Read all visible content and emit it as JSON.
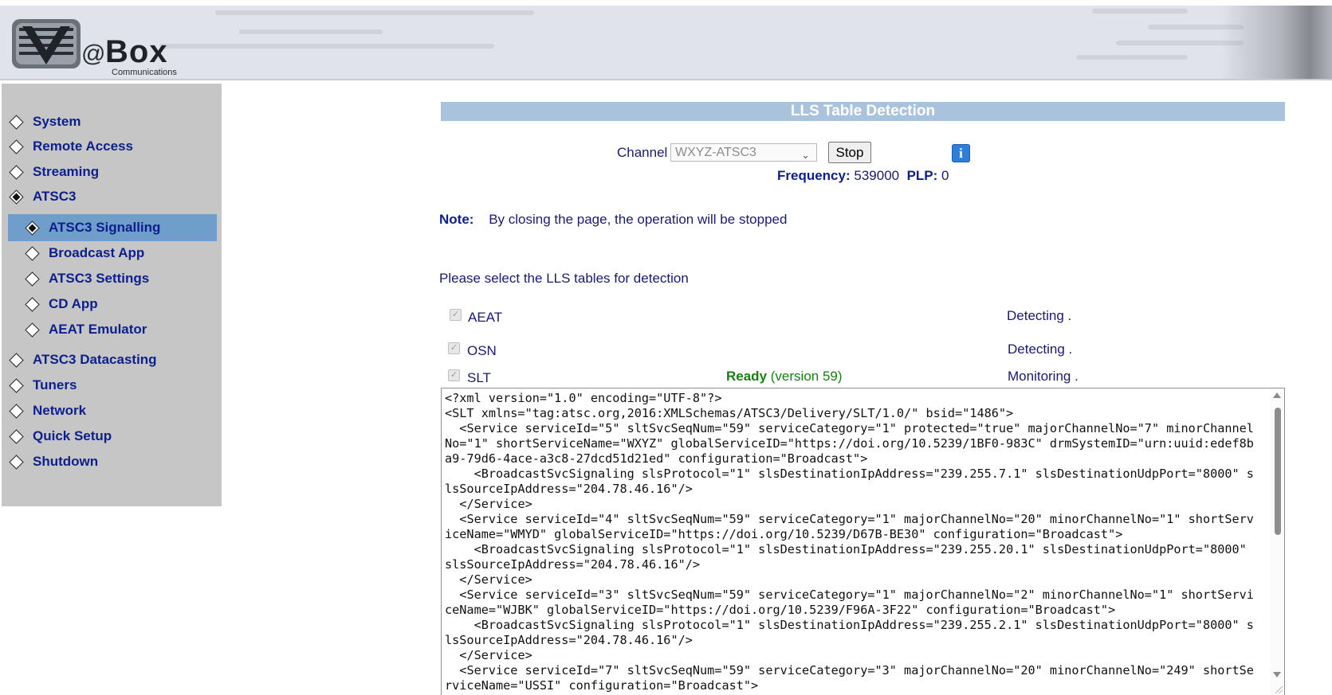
{
  "header": {
    "brand_icon": "vabox-logo",
    "brand_at": "@",
    "brand_box": "Box",
    "brand_sub": "Communications"
  },
  "sidebar": {
    "items": [
      {
        "label": "System",
        "icon": "diamond-icon"
      },
      {
        "label": "Remote Access",
        "icon": "diamond-icon"
      },
      {
        "label": "Streaming",
        "icon": "diamond-icon"
      },
      {
        "label": "ATSC3",
        "icon": "diamond-filled-icon"
      },
      {
        "label": "ATSC3 Signalling",
        "icon": "diamond-filled-icon",
        "active": true
      },
      {
        "label": "Broadcast App",
        "icon": "diamond-icon"
      },
      {
        "label": "ATSC3 Settings",
        "icon": "diamond-icon"
      },
      {
        "label": "CD App",
        "icon": "diamond-icon"
      },
      {
        "label": "AEAT Emulator",
        "icon": "diamond-icon"
      },
      {
        "label": "ATSC3 Datacasting",
        "icon": "diamond-icon"
      },
      {
        "label": "Tuners",
        "icon": "diamond-icon"
      },
      {
        "label": "Network",
        "icon": "diamond-icon"
      },
      {
        "label": "Quick Setup",
        "icon": "diamond-icon"
      },
      {
        "label": "Shutdown",
        "icon": "diamond-icon"
      }
    ],
    "active_color": "#6f9ecb"
  },
  "main": {
    "title": "LLS Table Detection",
    "channel_label": "Channel",
    "channel_value": "WXYZ-ATSC3",
    "stop_label": "Stop",
    "info_icon": "info-icon",
    "frequency_label": "Frequency:",
    "frequency_value": "539000",
    "plp_label": "PLP:",
    "plp_value": "0",
    "note_label": "Note:",
    "note_text": "By closing the page, the operation will be stopped",
    "select_msg": "Please select the LLS tables for detection",
    "tables": [
      {
        "name": "AEAT",
        "checked": true,
        "status": "Detecting ."
      },
      {
        "name": "OSN",
        "checked": true,
        "status": "Detecting ."
      },
      {
        "name": "SLT",
        "checked": true,
        "ready": "Ready",
        "ready_version": "(version 59)",
        "status": "Monitoring ."
      }
    ],
    "xml": "<?xml version=\"1.0\" encoding=\"UTF-8\"?>\n<SLT xmlns=\"tag:atsc.org,2016:XMLSchemas/ATSC3/Delivery/SLT/1.0/\" bsid=\"1486\">\n  <Service serviceId=\"5\" sltSvcSeqNum=\"59\" serviceCategory=\"1\" protected=\"true\" majorChannelNo=\"7\" minorChannelNo=\"1\" shortServiceName=\"WXYZ\" globalServiceID=\"https://doi.org/10.5239/1BF0-983C\" drmSystemID=\"urn:uuid:edef8ba9-79d6-4ace-a3c8-27dcd51d21ed\" configuration=\"Broadcast\">\n    <BroadcastSvcSignaling slsProtocol=\"1\" slsDestinationIpAddress=\"239.255.7.1\" slsDestinationUdpPort=\"8000\" slsSourceIpAddress=\"204.78.46.16\"/>\n  </Service>\n  <Service serviceId=\"4\" sltSvcSeqNum=\"59\" serviceCategory=\"1\" majorChannelNo=\"20\" minorChannelNo=\"1\" shortServiceName=\"WMYD\" globalServiceID=\"https://doi.org/10.5239/D67B-BE30\" configuration=\"Broadcast\">\n    <BroadcastSvcSignaling slsProtocol=\"1\" slsDestinationIpAddress=\"239.255.20.1\" slsDestinationUdpPort=\"8000\" slsSourceIpAddress=\"204.78.46.16\"/>\n  </Service>\n  <Service serviceId=\"3\" sltSvcSeqNum=\"59\" serviceCategory=\"1\" majorChannelNo=\"2\" minorChannelNo=\"1\" shortServiceName=\"WJBK\" globalServiceID=\"https://doi.org/10.5239/F96A-3F22\" configuration=\"Broadcast\">\n    <BroadcastSvcSignaling slsProtocol=\"1\" slsDestinationIpAddress=\"239.255.2.1\" slsDestinationUdpPort=\"8000\" slsSourceIpAddress=\"204.78.46.16\"/>\n  </Service>\n  <Service serviceId=\"7\" sltSvcSeqNum=\"59\" serviceCategory=\"3\" majorChannelNo=\"20\" minorChannelNo=\"249\" shortServiceName=\"USSI\" configuration=\"Broadcast\">"
  },
  "colors": {
    "title_bar": "#a9c3dc",
    "nav_text": "#0d1f8c",
    "ready_green": "#15810f",
    "info_blue": "#2f7fd8"
  }
}
